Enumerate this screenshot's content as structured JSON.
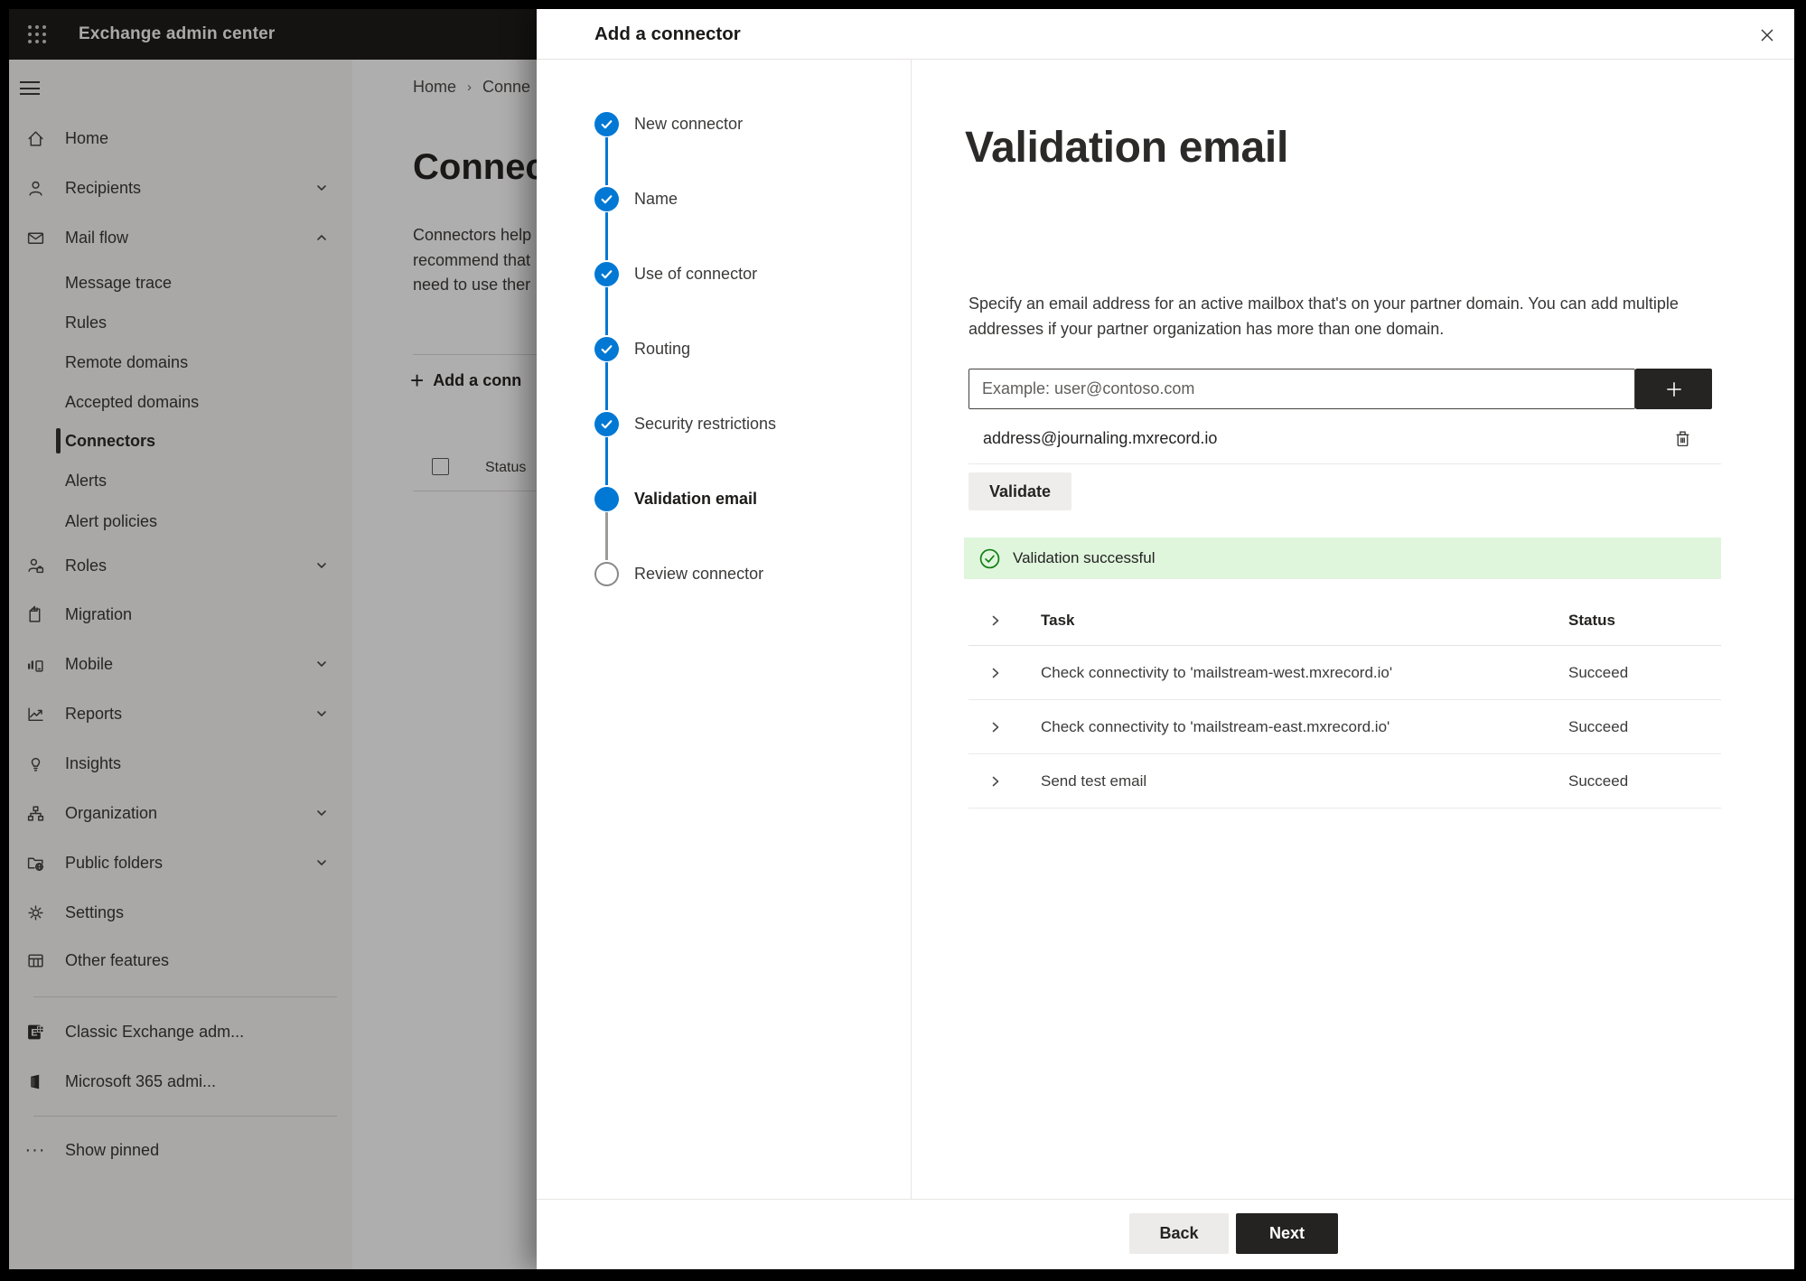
{
  "topbar": {
    "app_title": "Exchange admin center"
  },
  "background_page": {
    "breadcrumb_home": "Home",
    "breadcrumb_separator": "›",
    "breadcrumb_current": "Conne",
    "page_title": "Connec",
    "intro_lines": [
      "Connectors help",
      "recommend that",
      "need to use ther"
    ],
    "add_connector_button": "Add a conn",
    "status_column": "Status"
  },
  "sidebar": {
    "items_top": [
      {
        "label": "Home",
        "icon": "home-icon"
      },
      {
        "label": "Recipients",
        "icon": "person-icon",
        "chevron": "down"
      },
      {
        "label": "Mail flow",
        "icon": "mail-icon",
        "chevron": "up",
        "expanded": true
      }
    ],
    "mail_flow_children": [
      {
        "label": "Message trace"
      },
      {
        "label": "Rules"
      },
      {
        "label": "Remote domains"
      },
      {
        "label": "Accepted domains"
      },
      {
        "label": "Connectors",
        "selected": true
      },
      {
        "label": "Alerts"
      },
      {
        "label": "Alert policies"
      }
    ],
    "items_bottom": [
      {
        "label": "Roles",
        "icon": "roles-icon",
        "chevron": "down"
      },
      {
        "label": "Migration",
        "icon": "migration-icon"
      },
      {
        "label": "Mobile",
        "icon": "mobile-icon",
        "chevron": "down"
      },
      {
        "label": "Reports",
        "icon": "reports-icon",
        "chevron": "down"
      },
      {
        "label": "Insights",
        "icon": "insights-icon"
      },
      {
        "label": "Organization",
        "icon": "organization-icon",
        "chevron": "down"
      },
      {
        "label": "Public folders",
        "icon": "public-folders-icon",
        "chevron": "down"
      },
      {
        "label": "Settings",
        "icon": "settings-icon"
      },
      {
        "label": "Other features",
        "icon": "other-features-icon"
      }
    ],
    "footer_items": [
      {
        "label": "Classic Exchange adm...",
        "icon": "classic-exchange-icon"
      },
      {
        "label": "Microsoft 365 admi...",
        "icon": "microsoft-365-icon"
      }
    ],
    "show_pinned": "Show pinned"
  },
  "dialog": {
    "title": "Add a connector",
    "steps": [
      {
        "label": "New connector",
        "state": "complete"
      },
      {
        "label": "Name",
        "state": "complete"
      },
      {
        "label": "Use of connector",
        "state": "complete"
      },
      {
        "label": "Routing",
        "state": "complete"
      },
      {
        "label": "Security restrictions",
        "state": "complete"
      },
      {
        "label": "Validation email",
        "state": "current"
      },
      {
        "label": "Review connector",
        "state": "upcoming"
      }
    ],
    "content": {
      "heading": "Validation email",
      "description": "Specify an email address for an active mailbox that's on your partner domain. You can add multiple addresses if your partner organization has more than one domain.",
      "email_placeholder": "Example: user@contoso.com",
      "added_address": "address@journaling.mxrecord.io",
      "validate_button": "Validate",
      "success_banner": "Validation successful",
      "table": {
        "headers": {
          "task": "Task",
          "status": "Status"
        },
        "rows": [
          {
            "task": "Check connectivity to 'mailstream-west.mxrecord.io'",
            "status": "Succeed"
          },
          {
            "task": "Check connectivity to 'mailstream-east.mxrecord.io'",
            "status": "Succeed"
          },
          {
            "task": "Send test email",
            "status": "Succeed"
          }
        ]
      }
    },
    "footer": {
      "back_button": "Back",
      "next_button": "Next"
    }
  },
  "colors": {
    "accent_blue": "#0078d4",
    "success_green": "#107c10",
    "success_background": "#dff6dd",
    "dark_button": "#242322"
  }
}
